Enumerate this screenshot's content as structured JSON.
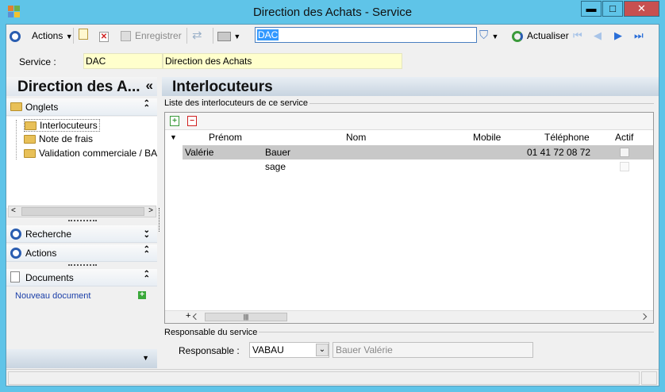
{
  "window": {
    "title": "Direction des Achats -  Service",
    "minimize_glyph": "▬",
    "maximize_glyph": "□",
    "close_glyph": "✕"
  },
  "toolbar": {
    "actions_label": "Actions",
    "save_label": "Enregistrer",
    "search_value": "DAC",
    "refresh_label": "Actualiser"
  },
  "service": {
    "label": "Service :",
    "code": "DAC",
    "name": "Direction des Achats"
  },
  "left": {
    "header": "Direction des A...",
    "collapse_glyph": "«",
    "onglets_label": "Onglets",
    "tree_items": [
      "Interlocuteurs",
      "Note de frais",
      "Validation commerciale / BA"
    ],
    "recherche_label": "Recherche",
    "actions_label": "Actions",
    "documents_label": "Documents",
    "new_document_label": "Nouveau document"
  },
  "right": {
    "header": "Interlocuteurs",
    "group_title": "Liste des interlocuteurs de ce service",
    "columns": [
      "Prénom",
      "Nom",
      "Mobile",
      "Téléphone",
      "Actif"
    ],
    "rows": [
      {
        "prenom": "Valérie",
        "nom": "Bauer",
        "mobile": "",
        "telephone": "01 41 72 08 72",
        "actif": false
      },
      {
        "prenom": "",
        "nom": "sage",
        "mobile": "",
        "telephone": "",
        "actif": false
      }
    ],
    "responsable_group": "Responsable du service",
    "responsable_label": "Responsable :",
    "responsable_code": "VABAU",
    "responsable_name": "Bauer Valérie"
  },
  "colors": {
    "window_frame": "#5fc4e8",
    "field_yellow": "#ffffcc",
    "selected_row": "#c8c8c8",
    "accent_blue": "#2a5db0"
  }
}
